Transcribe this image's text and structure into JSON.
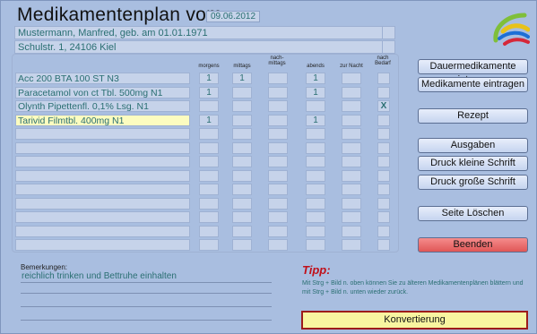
{
  "header": {
    "title": "Medikamentenplan vom",
    "date": "09.06.2012",
    "patient": "Mustermann, Manfred, geb. am 01.01.1971",
    "address": "Schulstr. 1, 24106 Kiel"
  },
  "columns": {
    "morgens": "morgens",
    "mittags": "mittags",
    "nachmittags": "nach-\nmittags",
    "abends": "abends",
    "zur_nacht": "zur Nacht",
    "nach_bedarf": "nach\nBedarf"
  },
  "medications": [
    {
      "name": "Acc 200 BTA 100 ST N3",
      "morgens": "1",
      "mittags": "1",
      "nachmittags": "",
      "abends": "1",
      "zur_nacht": "",
      "bedarf": ""
    },
    {
      "name": "Paracetamol von ct Tbl. 500mg N1",
      "morgens": "1",
      "mittags": "",
      "nachmittags": "",
      "abends": "1",
      "zur_nacht": "",
      "bedarf": ""
    },
    {
      "name": "Olynth Pipettenfl. 0,1% Lsg. N1",
      "morgens": "",
      "mittags": "",
      "nachmittags": "",
      "abends": "",
      "zur_nacht": "",
      "bedarf": "X"
    },
    {
      "name": "Tarivid Filmtbl. 400mg N1",
      "morgens": "1",
      "mittags": "",
      "nachmittags": "",
      "abends": "1",
      "zur_nacht": "",
      "bedarf": ""
    },
    {
      "name": "",
      "morgens": "",
      "mittags": "",
      "nachmittags": "",
      "abends": "",
      "zur_nacht": "",
      "bedarf": ""
    },
    {
      "name": "",
      "morgens": "",
      "mittags": "",
      "nachmittags": "",
      "abends": "",
      "zur_nacht": "",
      "bedarf": ""
    },
    {
      "name": "",
      "morgens": "",
      "mittags": "",
      "nachmittags": "",
      "abends": "",
      "zur_nacht": "",
      "bedarf": ""
    },
    {
      "name": "",
      "morgens": "",
      "mittags": "",
      "nachmittags": "",
      "abends": "",
      "zur_nacht": "",
      "bedarf": ""
    },
    {
      "name": "",
      "morgens": "",
      "mittags": "",
      "nachmittags": "",
      "abends": "",
      "zur_nacht": "",
      "bedarf": ""
    },
    {
      "name": "",
      "morgens": "",
      "mittags": "",
      "nachmittags": "",
      "abends": "",
      "zur_nacht": "",
      "bedarf": ""
    },
    {
      "name": "",
      "morgens": "",
      "mittags": "",
      "nachmittags": "",
      "abends": "",
      "zur_nacht": "",
      "bedarf": ""
    },
    {
      "name": "",
      "morgens": "",
      "mittags": "",
      "nachmittags": "",
      "abends": "",
      "zur_nacht": "",
      "bedarf": ""
    },
    {
      "name": "",
      "morgens": "",
      "mittags": "",
      "nachmittags": "",
      "abends": "",
      "zur_nacht": "",
      "bedarf": ""
    }
  ],
  "buttons": {
    "dauer": "Dauermedikamente eintragen",
    "medikamente": "Medikamente eintragen",
    "rezept": "Rezept",
    "ausgaben": "Ausgaben",
    "druck_klein": "Druck kleine Schrift",
    "druck_gross": "Druck große Schrift",
    "seite_loeschen": "Seite Löschen",
    "beenden": "Beenden",
    "konvertierung": "Konvertierung"
  },
  "notes": {
    "label": "Bemerkungen:",
    "text": "reichlich trinken und Bettruhe einhalten"
  },
  "tipp": {
    "title": "Tipp:",
    "text": "Mit Strg + Bild n. oben können Sie zu älteren Medikamentenplänen blättern und mit Strg + Bild n. unten wieder zurück."
  },
  "colors": {
    "background": "#a9bee0",
    "field": "#c6d3ea",
    "selected_row": "#fcfcc0",
    "text_teal": "#2a6f72",
    "danger": "#e05757",
    "tipp_red": "#c0101a"
  }
}
